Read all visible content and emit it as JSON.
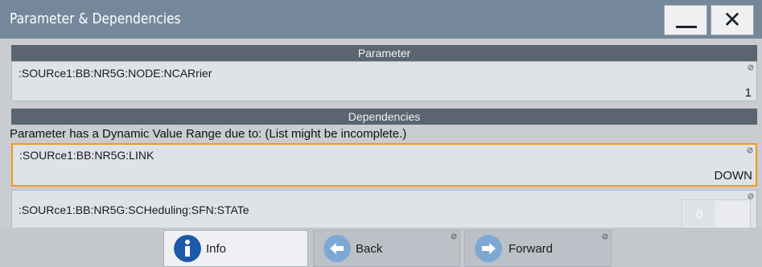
{
  "window": {
    "title": "Parameter & Dependencies",
    "minimize_icon": "minimize-icon",
    "close_glyph": "✕"
  },
  "parameter": {
    "header": "Parameter",
    "name": ":SOURce1:BB:NR5G:NODE:NCARrier",
    "value": "1"
  },
  "dependencies": {
    "header": "Dependencies",
    "note": "Parameter has a Dynamic Value Range due to: (List might be incomplete.)",
    "items": [
      {
        "name": ":SOURce1:BB:NR5G:LINK",
        "value": "DOWN"
      },
      {
        "name": ":SOURce1:BB:NR5G:SCHeduling:SFN:STATe",
        "value": "0"
      }
    ]
  },
  "nav": {
    "info_label": "Info",
    "back_label": "Back",
    "forward_label": "Forward"
  },
  "colors": {
    "titlebar": "#75889b",
    "header": "#5a6570",
    "focus": "#f19a1e",
    "info_blue": "#1b5aa6",
    "nav_circle": "#7ea8d4"
  }
}
